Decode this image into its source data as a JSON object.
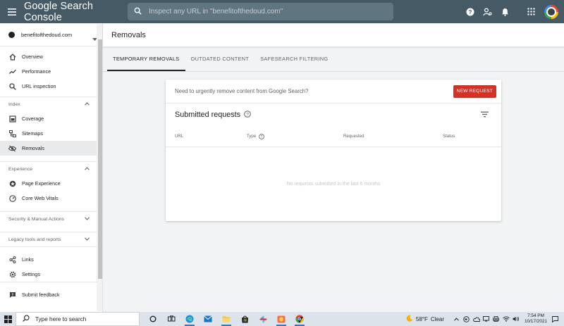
{
  "app": {
    "title": "Google Search Console"
  },
  "search": {
    "placeholder": "Inspect any URL in \"benefitofthedoud.com\""
  },
  "property": {
    "name": "benefitofthedoud.com"
  },
  "sidebar": {
    "top_items": [
      {
        "label": "Overview"
      },
      {
        "label": "Performance"
      },
      {
        "label": "URL inspection"
      }
    ],
    "sections": [
      {
        "label": "Index",
        "items": [
          {
            "label": "Coverage"
          },
          {
            "label": "Sitemaps"
          },
          {
            "label": "Removals"
          }
        ]
      },
      {
        "label": "Experience",
        "items": [
          {
            "label": "Page Experience"
          },
          {
            "label": "Core Web Vitals"
          }
        ]
      },
      {
        "label": "Security & Manual Actions"
      },
      {
        "label": "Legacy tools and reports"
      }
    ],
    "bottom_items": [
      {
        "label": "Links"
      },
      {
        "label": "Settings"
      },
      {
        "label": "Submit feedback"
      }
    ]
  },
  "page": {
    "title": "Removals",
    "tabs": [
      {
        "label": "TEMPORARY REMOVALS",
        "active": true
      },
      {
        "label": "OUTDATED CONTENT"
      },
      {
        "label": "SAFESEARCH FILTERING"
      }
    ],
    "card": {
      "question": "Need to urgently remove content from Google Search?",
      "new_request": "NEW REQUEST",
      "submitted_title": "Submitted requests",
      "columns": {
        "url": "URL",
        "type": "Type",
        "requested": "Requested",
        "status": "Status"
      },
      "empty_message": "No requests submitted in the last 6 months"
    }
  },
  "taskbar": {
    "search_placeholder": "Type here to search",
    "weather_temp": "58°F",
    "weather_text": "Clear",
    "time": "7:54 PM",
    "date": "10/17/2021"
  },
  "colors": {
    "topbar": "#455a64",
    "accent_red": "#d93025",
    "active_nav": "#e9eaec"
  }
}
